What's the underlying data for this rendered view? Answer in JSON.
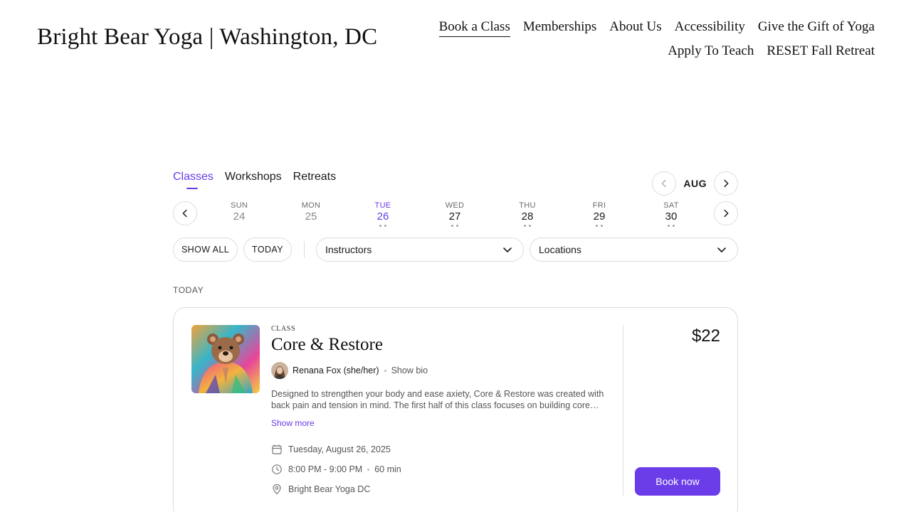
{
  "site": {
    "title": "Bright Bear Yoga | Washington, DC"
  },
  "nav": {
    "row1": [
      "Book a Class",
      "Memberships",
      "About Us",
      "Accessibility",
      "Give the Gift of Yoga"
    ],
    "row2": [
      "Apply To Teach",
      "RESET Fall Retreat"
    ],
    "active": "Book a Class"
  },
  "widget": {
    "tabs": [
      "Classes",
      "Workshops",
      "Retreats"
    ],
    "active_tab": "Classes",
    "month": "AUG",
    "days": [
      {
        "dow": "SUN",
        "num": "24",
        "dots": 0,
        "muted": true
      },
      {
        "dow": "MON",
        "num": "25",
        "dots": 0,
        "muted": true
      },
      {
        "dow": "TUE",
        "num": "26",
        "dots": 2,
        "active": true
      },
      {
        "dow": "WED",
        "num": "27",
        "dots": 2
      },
      {
        "dow": "THU",
        "num": "28",
        "dots": 2
      },
      {
        "dow": "FRI",
        "num": "29",
        "dots": 2
      },
      {
        "dow": "SAT",
        "num": "30",
        "dots": 2
      }
    ],
    "filters": {
      "show_all": "SHOW ALL",
      "today": "TODAY",
      "instructors": "Instructors",
      "locations": "Locations"
    },
    "section_label": "TODAY",
    "card": {
      "kicker": "CLASS",
      "title": "Core & Restore",
      "instructor": "Renana Fox (she/her)",
      "show_bio": "Show bio",
      "description": "Designed to strengthen your body and ease axiety, Core & Restore was created with back pain and tension in mind. The first half of this class focuses on building core…",
      "show_more": "Show more",
      "date": "Tuesday, August 26, 2025",
      "time": "8:00 PM - 9:00 PM",
      "duration": "60 min",
      "location": "Bright Bear Yoga DC",
      "price": "$22",
      "book_label": "Book now"
    }
  },
  "colors": {
    "accent": "#6a3de8",
    "border": "#dcdcdc",
    "muted_text": "#555555"
  },
  "icons": {
    "prev": "chevron-left-icon",
    "next": "chevron-right-icon",
    "dropdown": "chevron-down-icon",
    "calendar": "calendar-icon",
    "clock": "clock-icon",
    "location": "map-pin-icon"
  }
}
